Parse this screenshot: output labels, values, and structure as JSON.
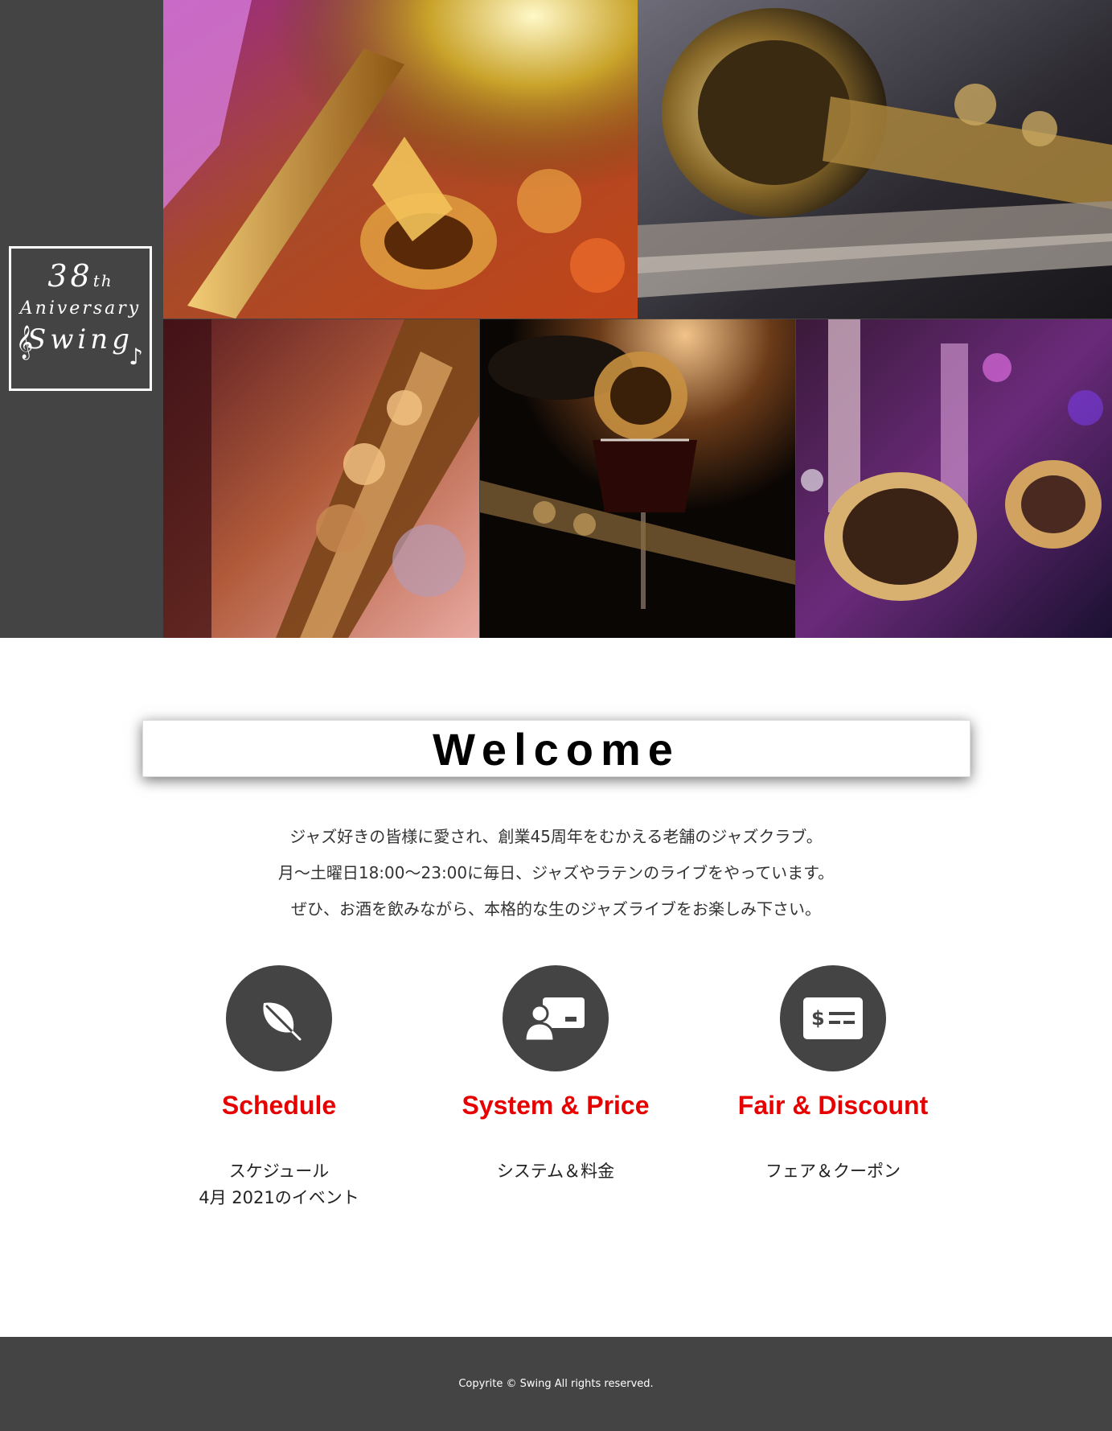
{
  "logo": {
    "line1_number": "38",
    "line1_suffix": "th",
    "line2": "Aniversary",
    "line3": "Swing",
    "clef_glyph": "𝄞",
    "note_glyph": "♪"
  },
  "photos": [
    {
      "name": "saxophone-player-photo"
    },
    {
      "name": "saxophone-closeup-photo"
    },
    {
      "name": "saxophone-keys-photo"
    },
    {
      "name": "wine-glass-saxophone-photo"
    },
    {
      "name": "saxophones-stage-photo"
    }
  ],
  "welcome": {
    "title": "Welcome",
    "lines": [
      "ジャズ好きの皆様に愛され、創業45周年をむかえる老舗のジャズクラブ。",
      "月～土曜日18:00～23:00に毎日、ジャズやラテンのライブをやっています。",
      "ぜひ、お酒を飲みながら、本格的な生のジャズライブをお楽しみ下さい。"
    ]
  },
  "features": [
    {
      "title": "Schedule",
      "sub1": "スケジュール",
      "sub2": "4月 2021のイベント",
      "icon": "leaf-icon"
    },
    {
      "title": "System & Price",
      "sub1": "システム＆料金",
      "sub2": "",
      "icon": "presentation-icon"
    },
    {
      "title": "Fair & Discount",
      "sub1": "フェア＆クーポン",
      "sub2": "",
      "icon": "coupon-icon"
    }
  ],
  "footer": {
    "copyright": "Copyrite © Swing All rights reserved."
  },
  "colors": {
    "dark_gray": "#444444",
    "accent_red": "#e60000",
    "white": "#ffffff"
  }
}
